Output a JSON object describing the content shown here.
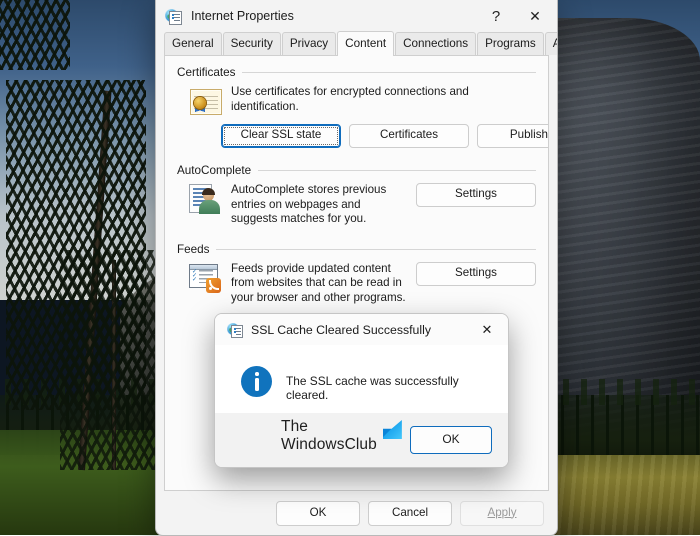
{
  "window": {
    "title": "Internet Properties",
    "icon": "globe-document-icon",
    "help_label": "?",
    "close_label": "✕"
  },
  "tabs": [
    {
      "label": "General",
      "active": false
    },
    {
      "label": "Security",
      "active": false
    },
    {
      "label": "Privacy",
      "active": false
    },
    {
      "label": "Content",
      "active": true
    },
    {
      "label": "Connections",
      "active": false
    },
    {
      "label": "Programs",
      "active": false
    },
    {
      "label": "Advanced",
      "active": false
    }
  ],
  "groups": {
    "certificates": {
      "title": "Certificates",
      "icon": "certificate-icon",
      "description": "Use certificates for encrypted connections and identification.",
      "buttons": {
        "clear_ssl": "Clear SSL state",
        "certificates": "Certificates",
        "publishers": "Publishers"
      }
    },
    "autocomplete": {
      "title": "AutoComplete",
      "icon": "autocomplete-person-icon",
      "description": "AutoComplete stores previous entries on webpages and suggests matches for you.",
      "settings_label": "Settings"
    },
    "feeds": {
      "title": "Feeds",
      "icon": "feeds-rss-icon",
      "description": "Feeds provide updated content from websites that can be read in your browser and other programs.",
      "settings_label": "Settings"
    }
  },
  "footer": {
    "ok": "OK",
    "cancel": "Cancel",
    "apply": "Apply",
    "apply_disabled": true
  },
  "dialog": {
    "title": "SSL Cache Cleared Successfully",
    "icon": "globe-document-icon",
    "close_label": "✕",
    "info_icon": "information-icon",
    "message": "The SSL cache was successfully cleared.",
    "ok": "OK",
    "watermark": {
      "line1": "The",
      "line2": "WindowsClub",
      "logo": "windowsclub-logo"
    }
  },
  "colors": {
    "accent": "#0f6cbd",
    "info": "#1073bd",
    "window_bg": "#f3f3f3",
    "panel_bg": "#fbfbfb",
    "close_hover": "#c42b1c"
  },
  "desktop": {
    "wallpaper": "yosemite-cliff-and-pines-photo"
  }
}
